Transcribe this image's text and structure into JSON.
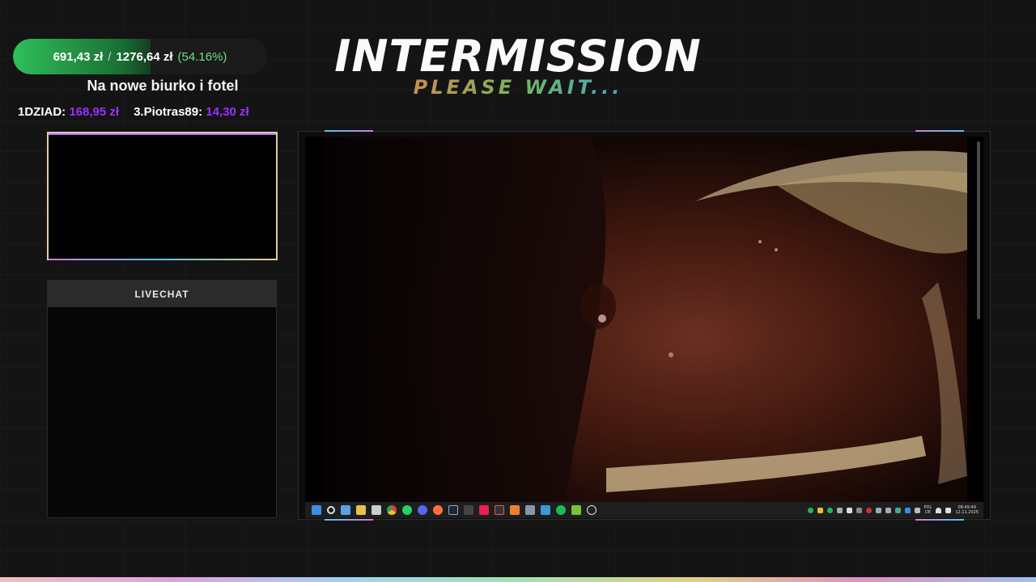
{
  "goal": {
    "current": "691,43 zł",
    "separator": "/",
    "target": "1276,64 zł",
    "percent": "(54.16%)",
    "progress_fraction": 0.5416,
    "title": "Na nowe biurko i fotel"
  },
  "donors": [
    {
      "name": "1DZIAD:",
      "amount": "168,95 zł"
    },
    {
      "name": "3.Piotras89:",
      "amount": "14,30 zł"
    }
  ],
  "header": {
    "title": "INTERMISSION",
    "subtitle": "PLEASE WAIT..."
  },
  "chat": {
    "header": "LIVECHAT"
  },
  "taskbar": {
    "icons": [
      "windows-start-icon",
      "search-icon",
      "widgets-icon",
      "file-explorer-icon",
      "calendar-icon",
      "chrome-icon",
      "whatsapp-icon",
      "discord-icon",
      "firefox-icon",
      "steam-icon",
      "app-icon",
      "tiktok-icon",
      "app-icon",
      "app-icon",
      "camera-icon",
      "photos-icon",
      "spotify-icon",
      "app-icon",
      "obs-icon"
    ],
    "language": "POL\nDE",
    "time": "08:49:49",
    "date": "12.11.2025"
  },
  "colors": {
    "goal_fill": "#2fbf5a",
    "donor_amount": "#9b30ff",
    "percent": "#6ee08a"
  }
}
